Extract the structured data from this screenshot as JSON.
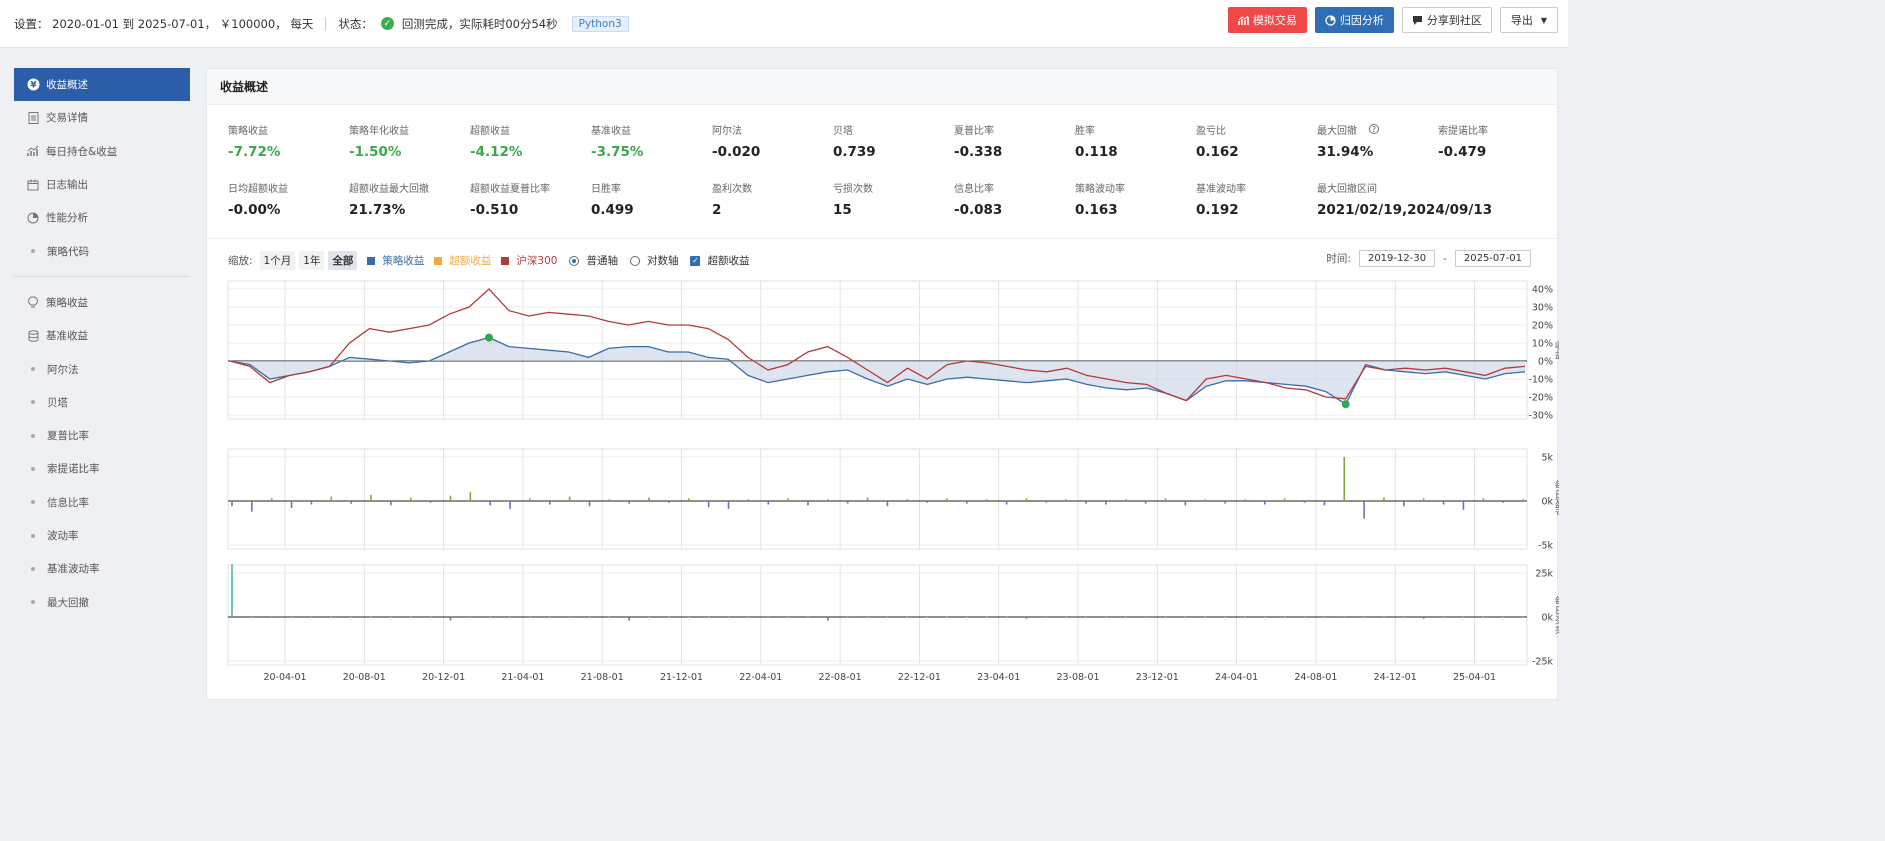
{
  "topbar": {
    "settings_text": "设置：  2020-01-01 到 2025-07-01， ￥100000， 每天",
    "status_label": "状态：",
    "status_text": "回测完成，实际耗时00分54秒",
    "python_badge": "Python3",
    "actions": {
      "simulate": "模拟交易",
      "attribution": "归因分析",
      "share": "分享到社区",
      "export": "导出"
    }
  },
  "sidebar": {
    "group1": [
      "收益概述",
      "交易详情",
      "每日持仓&收益",
      "日志输出",
      "性能分析",
      "策略代码"
    ],
    "group2": [
      "策略收益",
      "基准收益",
      "阿尔法",
      "贝塔",
      "夏普比率",
      "索提诺比率",
      "信息比率",
      "波动率",
      "基准波动率",
      "最大回撤"
    ]
  },
  "panel": {
    "title": "收益概述"
  },
  "metrics_row1": [
    {
      "label": "策略收益",
      "value": "-7.72%",
      "color": "green"
    },
    {
      "label": "策略年化收益",
      "value": "-1.50%",
      "color": "green"
    },
    {
      "label": "超额收益",
      "value": "-4.12%",
      "color": "green"
    },
    {
      "label": "基准收益",
      "value": "-3.75%",
      "color": "green"
    },
    {
      "label": "阿尔法",
      "value": "-0.020",
      "color": ""
    },
    {
      "label": "贝塔",
      "value": "0.739",
      "color": ""
    },
    {
      "label": "夏普比率",
      "value": "-0.338",
      "color": ""
    },
    {
      "label": "胜率",
      "value": "0.118",
      "color": ""
    },
    {
      "label": "盈亏比",
      "value": "0.162",
      "color": ""
    },
    {
      "label": "最大回撤",
      "value": "31.94%",
      "color": "",
      "help": "?"
    },
    {
      "label": "索提诺比率",
      "value": "-0.479",
      "color": ""
    }
  ],
  "metrics_row2": [
    {
      "label": "日均超额收益",
      "value": "-0.00%"
    },
    {
      "label": "超额收益最大回撤",
      "value": "21.73%"
    },
    {
      "label": "超额收益夏普比率",
      "value": "-0.510"
    },
    {
      "label": "日胜率",
      "value": "0.499"
    },
    {
      "label": "盈利次数",
      "value": "2"
    },
    {
      "label": "亏损次数",
      "value": "15"
    },
    {
      "label": "信息比率",
      "value": "-0.083"
    },
    {
      "label": "策略波动率",
      "value": "0.163"
    },
    {
      "label": "基准波动率",
      "value": "0.192"
    },
    {
      "label": "最大回撤区间",
      "value": "2021/02/19,2024/09/13"
    }
  ],
  "controls": {
    "zoom_label": "缩放:",
    "zoom_options": [
      "1个月",
      "1年",
      "全部"
    ],
    "legend": [
      "策略收益",
      "超额收益",
      "沪深300"
    ],
    "axis_normal": "普通轴",
    "axis_log": "对数轴",
    "excess_checkbox": "超额收益",
    "time_label": "时间:",
    "date_from": "2019-12-30",
    "date_sep": "-",
    "date_to": "2025-07-01",
    "check_mark": "✓"
  },
  "colors": {
    "strategy": "#3b6ea8",
    "excess": "#f5a742",
    "benchmark": "#b33a3a",
    "accent_blue": "#2c5da8"
  },
  "chart_data": [
    {
      "type": "line",
      "ylabel": "收益",
      "yticks": [
        "40%",
        "30%",
        "20%",
        "10%",
        "0%",
        "-10%",
        "-20%",
        "-30%"
      ],
      "ylim": [
        -30,
        40
      ],
      "x": [
        "2020-01",
        "2020-02",
        "2020-03",
        "2020-04",
        "2020-05",
        "2020-06",
        "2020-07",
        "2020-08",
        "2020-09",
        "2020-10",
        "2020-11",
        "2020-12",
        "2021-01",
        "2021-02",
        "2021-03",
        "2021-04",
        "2021-05",
        "2021-06",
        "2021-07",
        "2021-08",
        "2021-09",
        "2021-10",
        "2021-11",
        "2021-12",
        "2022-01",
        "2022-02",
        "2022-03",
        "2022-04",
        "2022-05",
        "2022-06",
        "2022-07",
        "2022-08",
        "2022-09",
        "2022-10",
        "2022-11",
        "2022-12",
        "2023-01",
        "2023-02",
        "2023-03",
        "2023-04",
        "2023-05",
        "2023-06",
        "2023-07",
        "2023-08",
        "2023-09",
        "2023-10",
        "2023-11",
        "2023-12",
        "2024-01",
        "2024-02",
        "2024-03",
        "2024-04",
        "2024-05",
        "2024-06",
        "2024-07",
        "2024-08",
        "2024-09",
        "2024-10",
        "2024-11",
        "2024-12",
        "2025-01",
        "2025-02",
        "2025-03",
        "2025-04",
        "2025-05",
        "2025-06"
      ],
      "series": [
        {
          "name": "策略收益",
          "values": [
            0,
            -2,
            -10,
            -8,
            -6,
            -3,
            2,
            1,
            0,
            -1,
            0,
            5,
            10,
            13,
            8,
            7,
            6,
            5,
            2,
            7,
            8,
            8,
            5,
            5,
            2,
            1,
            -8,
            -12,
            -10,
            -8,
            -6,
            -5,
            -10,
            -14,
            -10,
            -13,
            -10,
            -9,
            -10,
            -11,
            -12,
            -11,
            -10,
            -13,
            -15,
            -16,
            -15,
            -18,
            -22,
            -14,
            -11,
            -11,
            -12,
            -13,
            -14,
            -17,
            -24,
            -2,
            -5,
            -6,
            -7,
            -6,
            -8,
            -10,
            -7,
            -6
          ]
        },
        {
          "name": "沪深300",
          "values": [
            0,
            -3,
            -12,
            -8,
            -6,
            -3,
            10,
            18,
            16,
            18,
            20,
            26,
            30,
            40,
            28,
            25,
            27,
            26,
            25,
            22,
            20,
            22,
            20,
            20,
            18,
            12,
            2,
            -5,
            -2,
            5,
            8,
            2,
            -5,
            -12,
            -4,
            -10,
            -2,
            0,
            -1,
            -3,
            -5,
            -6,
            -4,
            -8,
            -10,
            -12,
            -13,
            -18,
            -22,
            -10,
            -8,
            -10,
            -12,
            -15,
            -16,
            -20,
            -21,
            -3,
            -5,
            -4,
            -5,
            -4,
            -6,
            -8,
            -4,
            -3
          ]
        }
      ],
      "markers": [
        {
          "x": "2021-02",
          "y": 13
        },
        {
          "x": "2024-09",
          "y": -24
        }
      ]
    },
    {
      "type": "bar",
      "ylabel": "每日盈亏",
      "yticks": [
        "5k",
        "0k",
        "-5k"
      ],
      "ylim": [
        -5,
        5
      ],
      "values": [
        -0.6,
        -1.2,
        0.3,
        -0.8,
        -0.4,
        0.5,
        -0.3,
        0.7,
        -0.5,
        0.4,
        -0.2,
        0.6,
        1.0,
        -0.5,
        -0.9,
        0.3,
        -0.4,
        0.5,
        -0.6,
        0.2,
        -0.3,
        0.4,
        -0.2,
        0.3,
        -0.7,
        -0.9,
        0.2,
        -0.4,
        0.3,
        -0.5,
        0.2,
        -0.3,
        0.4,
        -0.6,
        0.2,
        -0.2,
        0.3,
        -0.3,
        0.2,
        -0.4,
        0.3,
        -0.2,
        0.2,
        -0.3,
        -0.4,
        0.2,
        -0.3,
        0.3,
        -0.5,
        0.2,
        -0.3,
        0.2,
        -0.4,
        0.3,
        -0.2,
        -0.5,
        5.0,
        -2.0,
        0.4,
        -0.6,
        0.3,
        -0.4,
        -1.0,
        0.3,
        -0.2,
        0.2
      ]
    },
    {
      "type": "bar",
      "ylabel": "每日买卖",
      "yticks": [
        "25k",
        "0k",
        "-25k"
      ],
      "ylim": [
        -25,
        25
      ],
      "values": [
        30,
        0,
        0,
        0,
        0,
        0,
        0,
        0,
        0,
        0,
        0,
        -2,
        0,
        0,
        0,
        0,
        0,
        0,
        0,
        0,
        -2,
        0,
        0,
        0,
        0,
        0,
        0,
        0,
        0,
        0,
        -2,
        0,
        0,
        0,
        0,
        0,
        0,
        0,
        0,
        0,
        -1,
        0,
        0,
        0,
        0,
        0,
        0,
        0,
        0,
        0,
        0,
        0,
        0,
        0,
        0,
        0,
        0,
        0,
        0,
        0,
        -1,
        0,
        0,
        0,
        0,
        0
      ]
    }
  ],
  "x_ticks": [
    "20-04-01",
    "20-08-01",
    "20-12-01",
    "21-04-01",
    "21-08-01",
    "21-12-01",
    "22-04-01",
    "22-08-01",
    "22-12-01",
    "23-04-01",
    "23-08-01",
    "23-12-01",
    "24-04-01",
    "24-08-01",
    "24-12-01",
    "25-04-01"
  ]
}
